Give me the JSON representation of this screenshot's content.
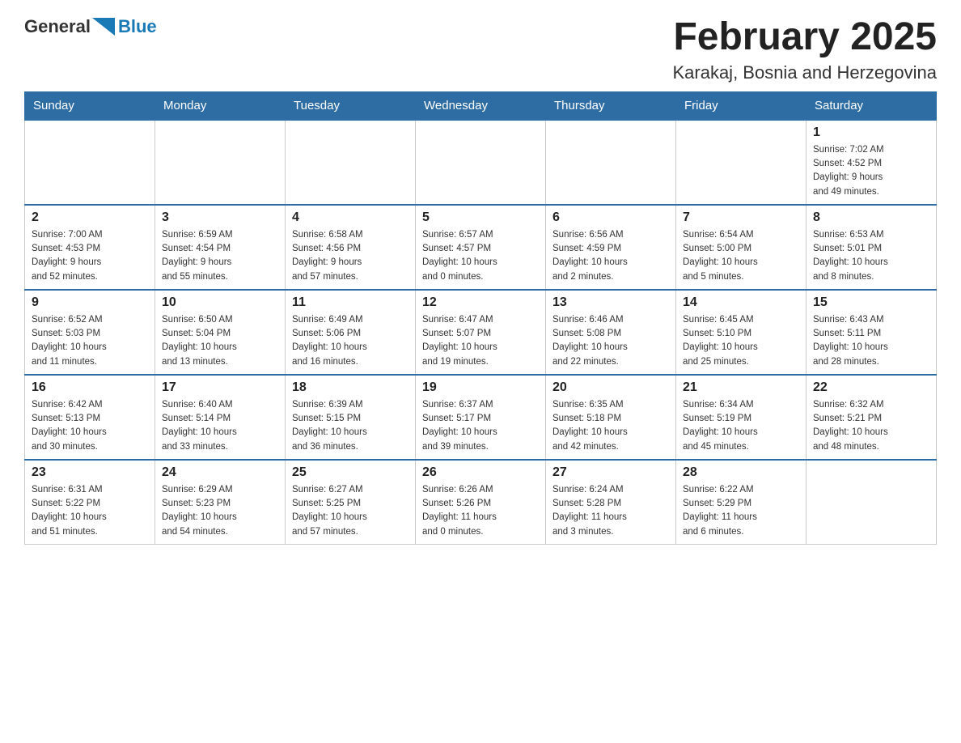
{
  "header": {
    "logo_general": "General",
    "logo_blue": "Blue",
    "month_title": "February 2025",
    "location": "Karakaj, Bosnia and Herzegovina"
  },
  "days_of_week": [
    "Sunday",
    "Monday",
    "Tuesday",
    "Wednesday",
    "Thursday",
    "Friday",
    "Saturday"
  ],
  "weeks": [
    [
      {
        "day": "",
        "info": ""
      },
      {
        "day": "",
        "info": ""
      },
      {
        "day": "",
        "info": ""
      },
      {
        "day": "",
        "info": ""
      },
      {
        "day": "",
        "info": ""
      },
      {
        "day": "",
        "info": ""
      },
      {
        "day": "1",
        "info": "Sunrise: 7:02 AM\nSunset: 4:52 PM\nDaylight: 9 hours\nand 49 minutes."
      }
    ],
    [
      {
        "day": "2",
        "info": "Sunrise: 7:00 AM\nSunset: 4:53 PM\nDaylight: 9 hours\nand 52 minutes."
      },
      {
        "day": "3",
        "info": "Sunrise: 6:59 AM\nSunset: 4:54 PM\nDaylight: 9 hours\nand 55 minutes."
      },
      {
        "day": "4",
        "info": "Sunrise: 6:58 AM\nSunset: 4:56 PM\nDaylight: 9 hours\nand 57 minutes."
      },
      {
        "day": "5",
        "info": "Sunrise: 6:57 AM\nSunset: 4:57 PM\nDaylight: 10 hours\nand 0 minutes."
      },
      {
        "day": "6",
        "info": "Sunrise: 6:56 AM\nSunset: 4:59 PM\nDaylight: 10 hours\nand 2 minutes."
      },
      {
        "day": "7",
        "info": "Sunrise: 6:54 AM\nSunset: 5:00 PM\nDaylight: 10 hours\nand 5 minutes."
      },
      {
        "day": "8",
        "info": "Sunrise: 6:53 AM\nSunset: 5:01 PM\nDaylight: 10 hours\nand 8 minutes."
      }
    ],
    [
      {
        "day": "9",
        "info": "Sunrise: 6:52 AM\nSunset: 5:03 PM\nDaylight: 10 hours\nand 11 minutes."
      },
      {
        "day": "10",
        "info": "Sunrise: 6:50 AM\nSunset: 5:04 PM\nDaylight: 10 hours\nand 13 minutes."
      },
      {
        "day": "11",
        "info": "Sunrise: 6:49 AM\nSunset: 5:06 PM\nDaylight: 10 hours\nand 16 minutes."
      },
      {
        "day": "12",
        "info": "Sunrise: 6:47 AM\nSunset: 5:07 PM\nDaylight: 10 hours\nand 19 minutes."
      },
      {
        "day": "13",
        "info": "Sunrise: 6:46 AM\nSunset: 5:08 PM\nDaylight: 10 hours\nand 22 minutes."
      },
      {
        "day": "14",
        "info": "Sunrise: 6:45 AM\nSunset: 5:10 PM\nDaylight: 10 hours\nand 25 minutes."
      },
      {
        "day": "15",
        "info": "Sunrise: 6:43 AM\nSunset: 5:11 PM\nDaylight: 10 hours\nand 28 minutes."
      }
    ],
    [
      {
        "day": "16",
        "info": "Sunrise: 6:42 AM\nSunset: 5:13 PM\nDaylight: 10 hours\nand 30 minutes."
      },
      {
        "day": "17",
        "info": "Sunrise: 6:40 AM\nSunset: 5:14 PM\nDaylight: 10 hours\nand 33 minutes."
      },
      {
        "day": "18",
        "info": "Sunrise: 6:39 AM\nSunset: 5:15 PM\nDaylight: 10 hours\nand 36 minutes."
      },
      {
        "day": "19",
        "info": "Sunrise: 6:37 AM\nSunset: 5:17 PM\nDaylight: 10 hours\nand 39 minutes."
      },
      {
        "day": "20",
        "info": "Sunrise: 6:35 AM\nSunset: 5:18 PM\nDaylight: 10 hours\nand 42 minutes."
      },
      {
        "day": "21",
        "info": "Sunrise: 6:34 AM\nSunset: 5:19 PM\nDaylight: 10 hours\nand 45 minutes."
      },
      {
        "day": "22",
        "info": "Sunrise: 6:32 AM\nSunset: 5:21 PM\nDaylight: 10 hours\nand 48 minutes."
      }
    ],
    [
      {
        "day": "23",
        "info": "Sunrise: 6:31 AM\nSunset: 5:22 PM\nDaylight: 10 hours\nand 51 minutes."
      },
      {
        "day": "24",
        "info": "Sunrise: 6:29 AM\nSunset: 5:23 PM\nDaylight: 10 hours\nand 54 minutes."
      },
      {
        "day": "25",
        "info": "Sunrise: 6:27 AM\nSunset: 5:25 PM\nDaylight: 10 hours\nand 57 minutes."
      },
      {
        "day": "26",
        "info": "Sunrise: 6:26 AM\nSunset: 5:26 PM\nDaylight: 11 hours\nand 0 minutes."
      },
      {
        "day": "27",
        "info": "Sunrise: 6:24 AM\nSunset: 5:28 PM\nDaylight: 11 hours\nand 3 minutes."
      },
      {
        "day": "28",
        "info": "Sunrise: 6:22 AM\nSunset: 5:29 PM\nDaylight: 11 hours\nand 6 minutes."
      },
      {
        "day": "",
        "info": ""
      }
    ]
  ]
}
